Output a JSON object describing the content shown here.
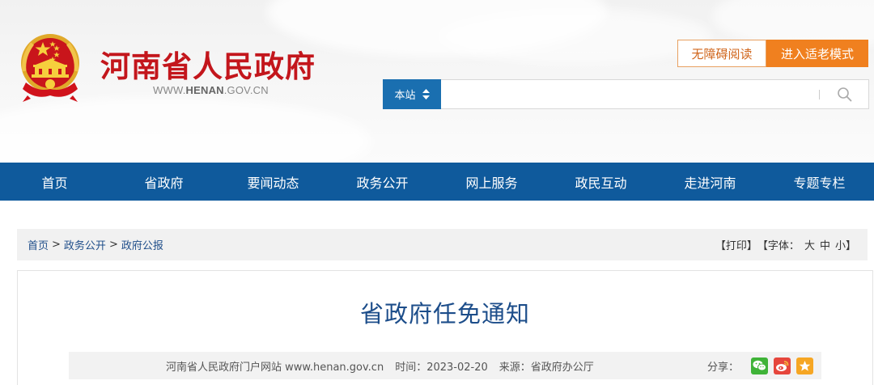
{
  "header": {
    "site_title": "河南省人民政府",
    "site_domain_prefix": "WWW.",
    "site_domain_main": "HENAN",
    "site_domain_suffix": ".GOV.CN",
    "accessibility_label": "无障碍阅读",
    "elder_mode_label": "进入适老模式",
    "search": {
      "scope_label": "本站",
      "placeholder": "",
      "value": ""
    }
  },
  "nav": {
    "items": [
      {
        "label": "首页"
      },
      {
        "label": "省政府"
      },
      {
        "label": "要闻动态"
      },
      {
        "label": "政务公开"
      },
      {
        "label": "网上服务"
      },
      {
        "label": "政民互动"
      },
      {
        "label": "走进河南"
      },
      {
        "label": "专题专栏"
      }
    ]
  },
  "breadcrumb": {
    "items": [
      "首页",
      "政务公开",
      "政府公报"
    ],
    "separator": ">"
  },
  "tools": {
    "print_label": "【打印】",
    "font_label_open": "【字体：",
    "size_large": "大",
    "size_medium": "中",
    "size_small": "小",
    "font_label_close": "】"
  },
  "article": {
    "title": "省政府任免通知",
    "meta": {
      "site": "河南省人民政府门户网站 www.henan.gov.cn",
      "time": "时间：2023-02-20",
      "source": "来源：省政府办公厅"
    },
    "share_label": "分享："
  },
  "colors": {
    "brand_red": "#c3161c",
    "nav_blue": "#0f5a9c",
    "search_blue": "#1a6fb0",
    "accent_orange": "#f0801f",
    "title_blue": "#1c4d8a",
    "wechat_green": "#3fb338",
    "weibo_red": "#e6463c",
    "favorite_orange": "#f6a623"
  },
  "icons": {
    "emblem": "national-emblem-icon",
    "search": "search-icon",
    "scope_arrows": "sort-arrows-icon",
    "wechat": "wechat-icon",
    "weibo": "weibo-icon",
    "favorite": "star-icon"
  }
}
